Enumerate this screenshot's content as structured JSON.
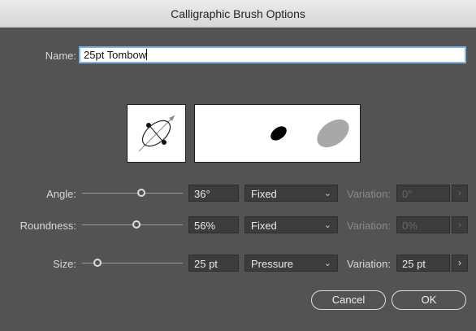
{
  "dialog": {
    "title": "Calligraphic Brush Options"
  },
  "name": {
    "label": "Name:",
    "value": "25pt Tombow"
  },
  "rows": [
    {
      "label": "Angle:",
      "slider_value": 0.36,
      "value": "36°",
      "mode": "Fixed",
      "variation_label": "Variation:",
      "variation_value": "0°",
      "variation_enabled": false
    },
    {
      "label": "Roundness:",
      "slider_value": 0.56,
      "value": "56%",
      "mode": "Fixed",
      "variation_label": "Variation:",
      "variation_value": "0%",
      "variation_enabled": false
    },
    {
      "label": "Size:",
      "slider_value": 0.018,
      "value": "25 pt",
      "mode": "Pressure",
      "variation_label": "Variation:",
      "variation_value": "25 pt",
      "variation_enabled": true
    }
  ],
  "buttons": {
    "cancel": "Cancel",
    "ok": "OK"
  },
  "icons": {
    "select": "chevron-down-icon",
    "stepper": "chevron-right-icon"
  },
  "colors": {
    "background": "#535353",
    "focus_ring": "#7cb7e8",
    "field": "#3c3c3c"
  }
}
